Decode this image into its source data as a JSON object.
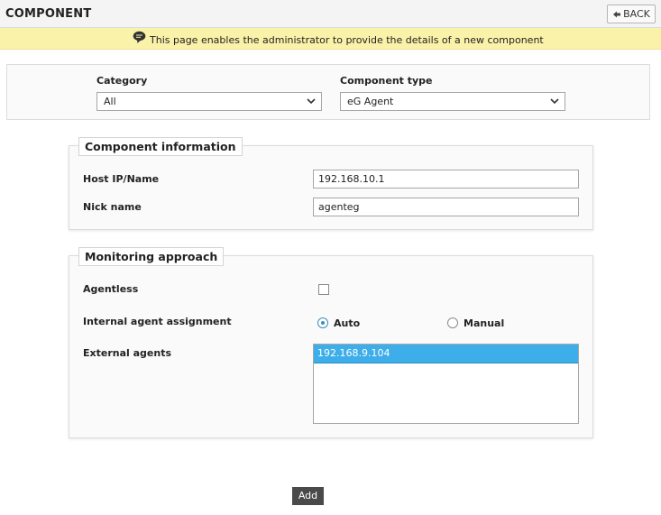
{
  "header": {
    "title": "COMPONENT",
    "back_label": "BACK"
  },
  "info": {
    "message": "This page enables the administrator to provide the details of a new component"
  },
  "selectors": {
    "category": {
      "label": "Category",
      "value": "All"
    },
    "component_type": {
      "label": "Component type",
      "value": "eG Agent"
    }
  },
  "component_info": {
    "legend": "Component information",
    "host": {
      "label": "Host IP/Name",
      "value": "192.168.10.1"
    },
    "nick": {
      "label": "Nick name",
      "value": "agenteg"
    }
  },
  "monitoring": {
    "legend": "Monitoring approach",
    "agentless": {
      "label": "Agentless",
      "checked": false
    },
    "assignment": {
      "label": "Internal agent assignment",
      "options": [
        {
          "label": "Auto",
          "selected": true
        },
        {
          "label": "Manual",
          "selected": false
        }
      ]
    },
    "external": {
      "label": "External agents",
      "items": [
        "192.168.9.104"
      ]
    }
  },
  "actions": {
    "add_label": "Add"
  },
  "colors": {
    "info_bg": "#fbf2a9",
    "accent": "#3daee9",
    "add_button": "#4a4a4a"
  }
}
